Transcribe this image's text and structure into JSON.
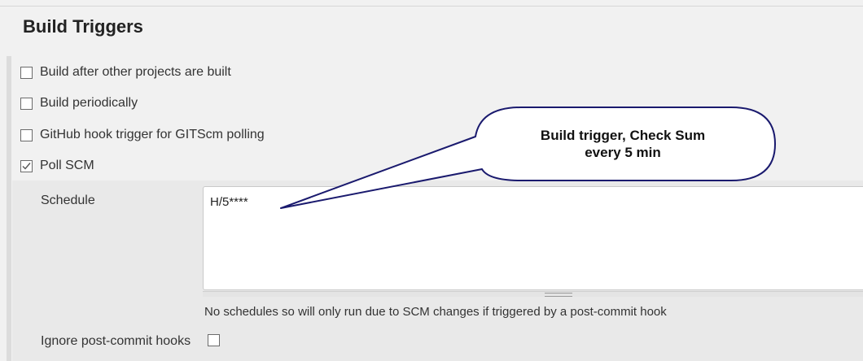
{
  "section": {
    "title": "Build Triggers"
  },
  "triggers": [
    {
      "label": "Build after other projects are built",
      "checked": false
    },
    {
      "label": "Build periodically",
      "checked": false
    },
    {
      "label": "GitHub hook trigger for GITScm polling",
      "checked": false
    },
    {
      "label": "Poll SCM",
      "checked": true
    }
  ],
  "schedule": {
    "label": "Schedule",
    "value": "H/5****",
    "help": "No schedules so will only run due to SCM changes if triggered by a post-commit hook"
  },
  "ignore_hooks": {
    "label": "Ignore post-commit hooks",
    "checked": false
  },
  "callout": {
    "line1": "Build trigger, Check Sum",
    "line2": "every 5 min"
  },
  "colors": {
    "callout_stroke": "#1a1a6e",
    "background": "#f1f1f1",
    "panel": "#e9e9e9"
  }
}
